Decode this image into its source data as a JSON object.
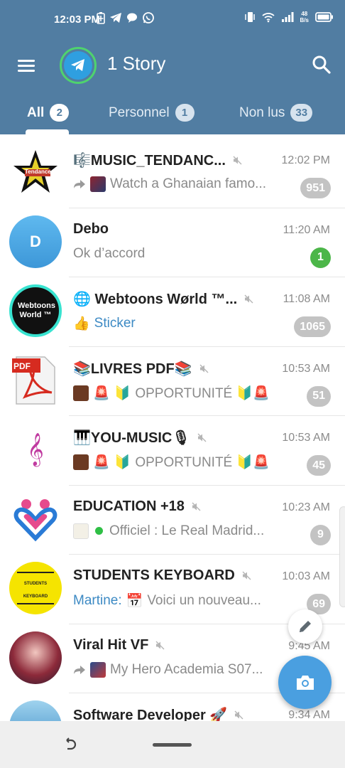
{
  "status_bar": {
    "time": "12:03 PM",
    "net_speed_value": "48",
    "net_speed_unit": "B/s"
  },
  "header": {
    "title": "1 Story"
  },
  "tabs": [
    {
      "label": "All",
      "count": "2",
      "active": true
    },
    {
      "label": "Personnel",
      "count": "1",
      "active": false
    },
    {
      "label": "Non lus",
      "count": "33",
      "active": false
    }
  ],
  "chats": [
    {
      "name": "🎼MUSIC_TENDANC...",
      "time": "12:02 PM",
      "message": "Watch a Ghanaian famo...",
      "count": "951",
      "avatar_text": "Tendance"
    },
    {
      "name": "Debo",
      "time": "11:20 AM",
      "message": "Ok d’accord",
      "count": "1",
      "avatar_text": "D"
    },
    {
      "name": "🌐 Webtoons Wørld ™...",
      "time": "11:08 AM",
      "message": "Sticker",
      "count": "1065",
      "avatar_text": "Webtoons World ™"
    },
    {
      "name": "📚LIVRES PDF📚",
      "time": "10:53 AM",
      "message": "OPPORTUNITÉ 🔰🚨",
      "count": "51",
      "avatar_text": "PDF"
    },
    {
      "name": "🎹YOU-MUSIC🎙",
      "time": "10:53 AM",
      "message": "OPPORTUNITÉ 🔰🚨",
      "count": "45",
      "avatar_text": "𝄞"
    },
    {
      "name": "EDUCATION +18",
      "time": "10:23 AM",
      "message": "Officiel :  Le Real Madrid...",
      "count": "9",
      "avatar_text": ""
    },
    {
      "name": "STUDENTS KEYBOARD",
      "time": "10:03 AM",
      "sender": "Martine:",
      "message": "Voici un nouveau...",
      "count": "69",
      "avatar_text": "STUDENTS KEYBOARD"
    },
    {
      "name": "Viral Hit VF",
      "time": "9:45 AM",
      "message": "My Hero Academia S07...",
      "count": "",
      "avatar_text": ""
    },
    {
      "name": "Software Developer 🚀",
      "time": "9:34 AM",
      "message": "",
      "count": "",
      "avatar_text": ""
    }
  ],
  "colors": {
    "header_bg": "#517da2",
    "unread_badge": "#c3c3c3",
    "green_badge": "#4cb649",
    "fab_blue": "#4a9fe0"
  },
  "icons": [
    "menu-icon",
    "telegram-logo-icon",
    "search-icon",
    "mute-icon",
    "forward-icon",
    "pencil-icon",
    "camera-icon",
    "back-gesture-icon"
  ]
}
